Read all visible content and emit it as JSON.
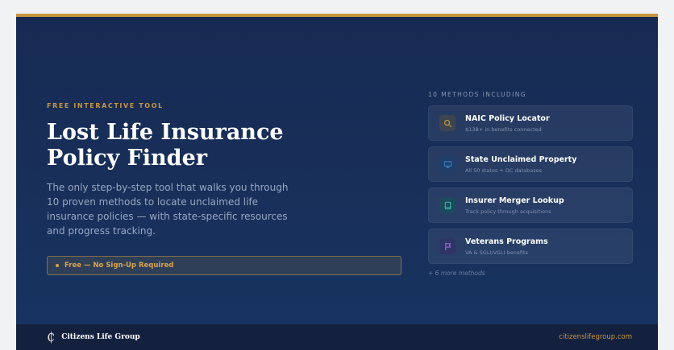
{
  "hero": {
    "eyebrow": "FREE INTERACTIVE TOOL",
    "title_line1": "Lost Life Insurance",
    "title_line2": "Policy Finder",
    "description": "The only step-by-step tool that walks you through 10 proven methods to locate unclaimed life insurance policies — with state-specific resources and progress tracking.",
    "badge": "Free — No Sign-Up Required"
  },
  "methods": {
    "heading": "10 METHODS INCLUDING",
    "items": [
      {
        "title": "NAIC Policy Locator",
        "subtitle": "$13B+ in benefits connected",
        "icon": "search-icon",
        "icon_color": "#c9953f",
        "icon_bg": "#3d4550"
      },
      {
        "title": "State Unclaimed Property",
        "subtitle": "All 50 states + DC databases",
        "icon": "monitor-icon",
        "icon_color": "#3b82c4",
        "icon_bg": "#1f3e6a"
      },
      {
        "title": "Insurer Merger Lookup",
        "subtitle": "Track policy through acquisitions",
        "icon": "book-icon",
        "icon_color": "#3fb8a6",
        "icon_bg": "#1d4a5c"
      },
      {
        "title": "Veterans Programs",
        "subtitle": "VA & SGLI/VGLI benefits",
        "icon": "flag-icon",
        "icon_color": "#9b6bd6",
        "icon_bg": "#2e3466"
      }
    ],
    "more": "+ 6 more methods"
  },
  "footer": {
    "brand_name": "Citizens Life Group",
    "website": "citizenslifegroup.com"
  },
  "colors": {
    "accent": "#c9953f",
    "background": "#172a52",
    "footer": "#13213f"
  }
}
